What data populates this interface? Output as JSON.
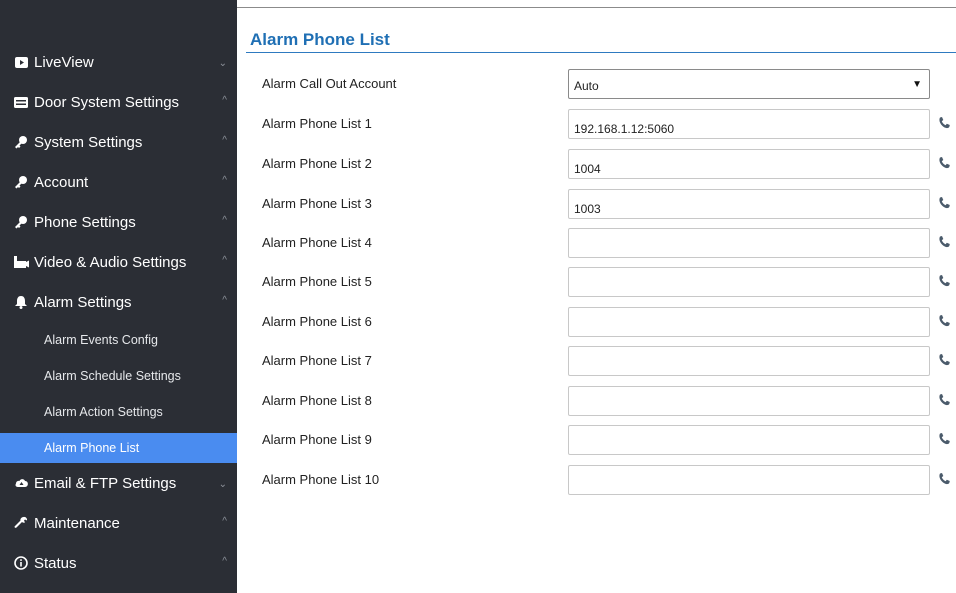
{
  "sidebar": {
    "items": [
      {
        "label": "LiveView",
        "icon": "video-icon",
        "chevron": "down"
      },
      {
        "label": "Door System Settings",
        "icon": "keypad-icon",
        "chevron": "up"
      },
      {
        "label": "System Settings",
        "icon": "key-icon",
        "chevron": "up"
      },
      {
        "label": "Account",
        "icon": "key-icon",
        "chevron": "up"
      },
      {
        "label": "Phone Settings",
        "icon": "key-icon",
        "chevron": "up"
      },
      {
        "label": "Video & Audio Settings",
        "icon": "camera-icon",
        "chevron": "up"
      },
      {
        "label": "Alarm Settings",
        "icon": "bell-icon",
        "chevron": "up"
      }
    ],
    "alarm_subitems": [
      {
        "label": "Alarm Events Config"
      },
      {
        "label": "Alarm Schedule Settings"
      },
      {
        "label": "Alarm Action Settings"
      },
      {
        "label": "Alarm Phone List",
        "active": true
      }
    ],
    "bottom_items": [
      {
        "label": "Email & FTP Settings",
        "icon": "cloud-icon",
        "chevron": "down"
      },
      {
        "label": "Maintenance",
        "icon": "wrench-icon",
        "chevron": "up"
      },
      {
        "label": "Status",
        "icon": "info-icon",
        "chevron": "up"
      }
    ]
  },
  "main": {
    "title": "Alarm Phone List",
    "call_out": {
      "label": "Alarm Call Out Account",
      "value": "Auto"
    },
    "phone_lists": [
      {
        "label": "Alarm Phone List 1",
        "value": "192.168.1.12:5060"
      },
      {
        "label": "Alarm Phone List 2",
        "value": "1004"
      },
      {
        "label": "Alarm Phone List 3",
        "value": "1003"
      },
      {
        "label": "Alarm Phone List 4",
        "value": ""
      },
      {
        "label": "Alarm Phone List 5",
        "value": ""
      },
      {
        "label": "Alarm Phone List 6",
        "value": ""
      },
      {
        "label": "Alarm Phone List 7",
        "value": ""
      },
      {
        "label": "Alarm Phone List 8",
        "value": ""
      },
      {
        "label": "Alarm Phone List 9",
        "value": ""
      },
      {
        "label": "Alarm Phone List 10",
        "value": ""
      }
    ]
  },
  "colors": {
    "sidebar_bg": "#2b2e35",
    "active": "#4a8cf0",
    "title": "#1f6fb4",
    "phone_icon": "#4b5b6b"
  }
}
